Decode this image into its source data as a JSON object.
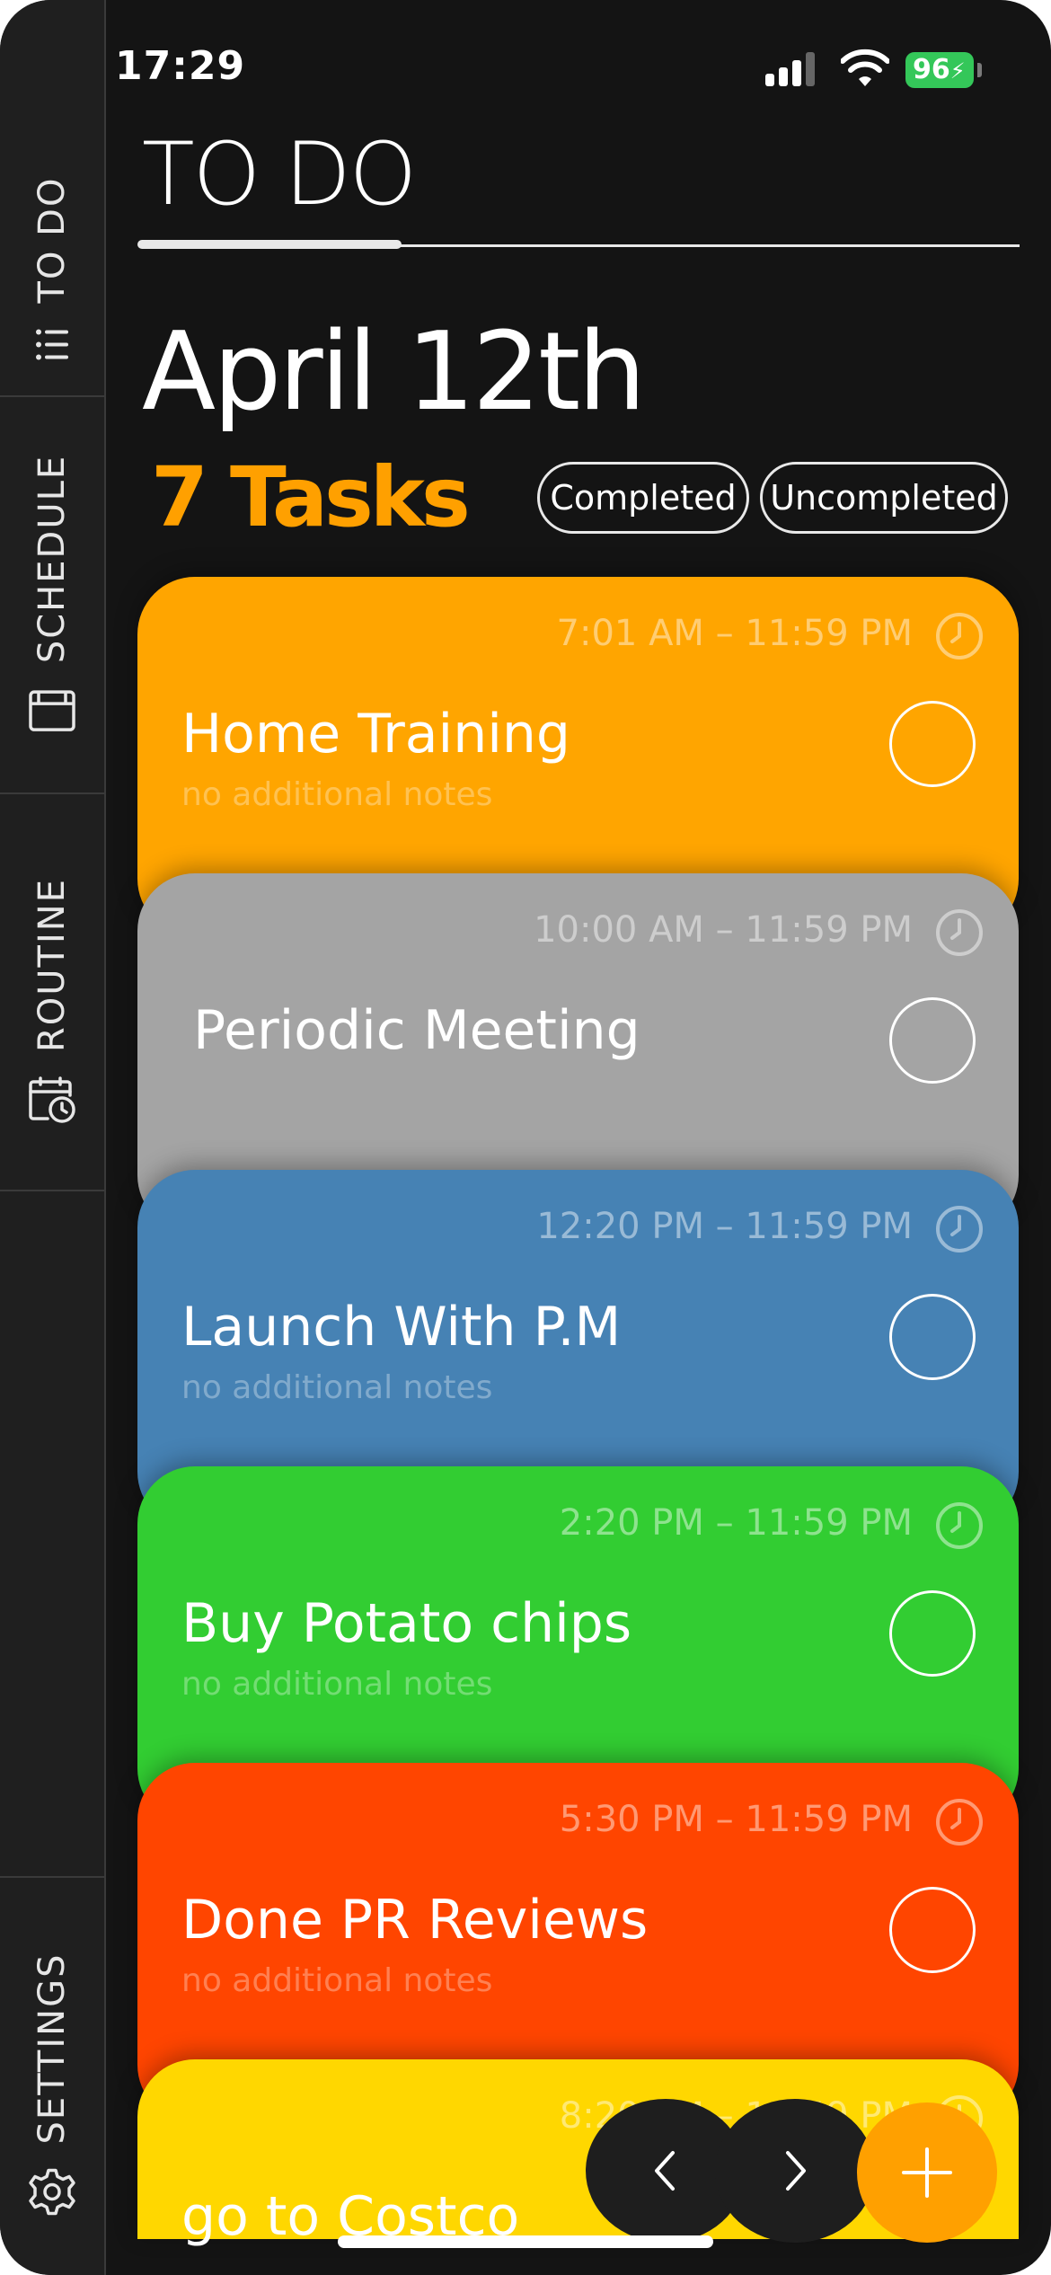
{
  "status_bar": {
    "time": "17:29",
    "battery": "96"
  },
  "sidebar": {
    "items": [
      {
        "label": "TO DO",
        "icon": "list-icon"
      },
      {
        "label": "SCHEDULE",
        "icon": "notebook-icon"
      },
      {
        "label": "ROUTINE",
        "icon": "calendar-clock-icon"
      },
      {
        "label": "SETTINGS",
        "icon": "gear-icon"
      }
    ]
  },
  "header": {
    "title": "TO DO"
  },
  "summary": {
    "date": "April 12th",
    "task_count": "7 Tasks"
  },
  "filters": {
    "completed": "Completed",
    "uncompleted": "Uncompleted"
  },
  "tasks": [
    {
      "time": "7:01 AM – 11:59 PM",
      "title": "Home Training",
      "notes": "no additional notes",
      "color": "#ffa500"
    },
    {
      "time": "10:00 AM – 11:59 PM",
      "title": "Periodic Meeting",
      "notes": "",
      "color": "#a4a4a4"
    },
    {
      "time": "12:20 PM – 11:59 PM",
      "title": "Launch With P.M",
      "notes": "no additional notes",
      "color": "#4682b4"
    },
    {
      "time": "2:20 PM – 11:59 PM",
      "title": "Buy Potato chips",
      "notes": "no additional notes",
      "color": "#32cd32"
    },
    {
      "time": "5:30 PM – 11:59 PM",
      "title": "Done PR Reviews",
      "notes": "no additional notes",
      "color": "#ff4500"
    },
    {
      "time": "8:20 PM – 11:59 PM",
      "title": "go to Costco",
      "notes": "",
      "color": "#ffd700"
    }
  ],
  "controls": {
    "prev_icon": "chevron-left-icon",
    "next_icon": "chevron-right-icon",
    "add_icon": "plus-icon",
    "accent": "#ffa000"
  }
}
